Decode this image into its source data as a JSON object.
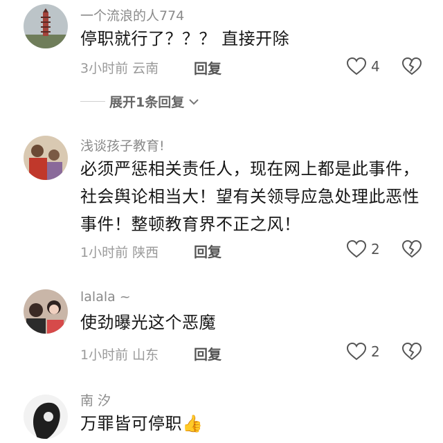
{
  "comments": [
    {
      "username": "一个流浪的人774",
      "text": "停职就行了？？？ 直接开除",
      "time": "3小时前",
      "location": "云南",
      "reply_label": "回复",
      "likes": "4",
      "avatar_icon": "pagoda-avatar"
    },
    {
      "username": "浅谈孩子教育!",
      "text": "必须严惩相关责任人，现在网上都是此事件，社会舆论相当大！望有关领导应急处理此恶性事件！整顿教育界不正之风！",
      "time": "1小时前",
      "location": "陕西",
      "reply_label": "回复",
      "likes": "2",
      "avatar_icon": "people-avatar"
    },
    {
      "username": "lalala ~",
      "text": "使劲曝光这个恶魔",
      "time": "1小时前",
      "location": "山东",
      "reply_label": "回复",
      "likes": "2",
      "avatar_icon": "girl-avatar"
    },
    {
      "username": "南 汐",
      "text": "万罪皆可停职",
      "emoji": "👍",
      "avatar_icon": "sketch-avatar"
    }
  ],
  "expand_replies": {
    "label": "展开1条回复"
  }
}
